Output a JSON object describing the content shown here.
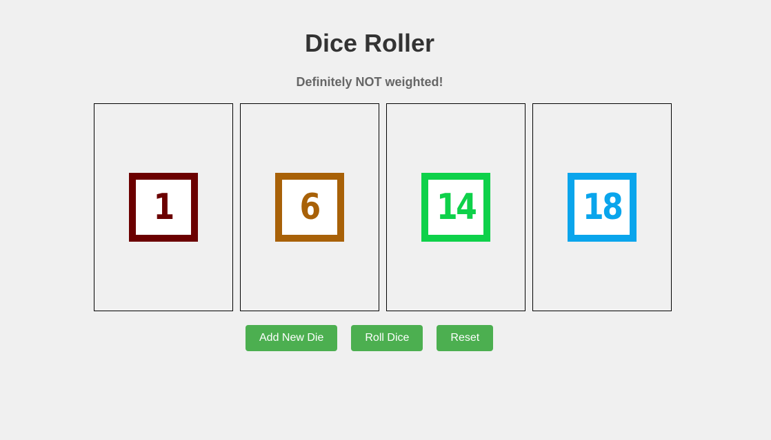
{
  "header": {
    "title": "Dice Roller",
    "subtitle": "Definitely NOT weighted!"
  },
  "dice": [
    {
      "value": "1",
      "color": "#6b0000"
    },
    {
      "value": "6",
      "color": "#a86108"
    },
    {
      "value": "14",
      "color": "#0ed14a"
    },
    {
      "value": "18",
      "color": "#0aa5ec"
    }
  ],
  "buttons": {
    "add_label": "Add New Die",
    "roll_label": "Roll Dice",
    "reset_label": "Reset",
    "color": "#4caf50"
  }
}
